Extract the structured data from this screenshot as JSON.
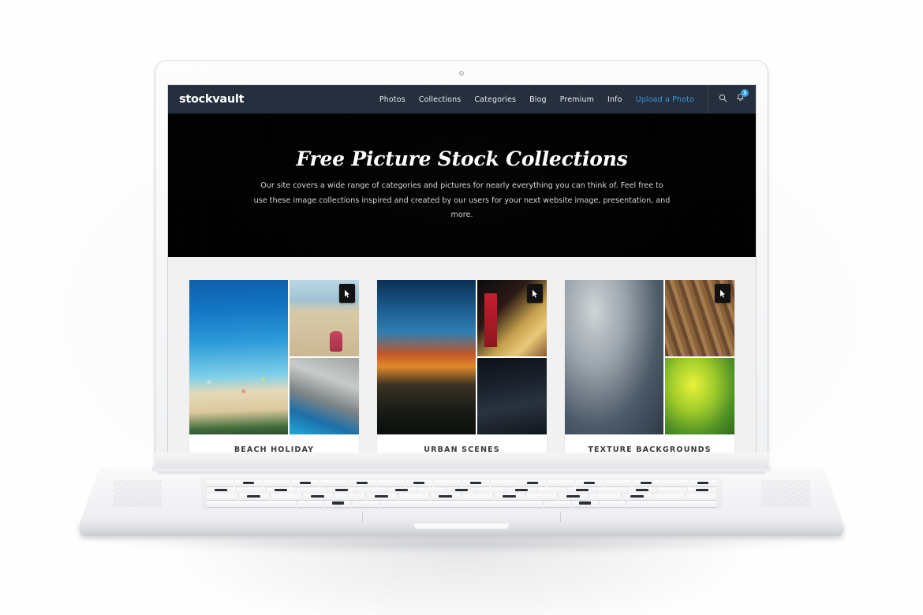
{
  "site": {
    "logo": "stockvault",
    "nav": [
      {
        "label": "Photos",
        "accent": false
      },
      {
        "label": "Collections",
        "accent": false
      },
      {
        "label": "Categories",
        "accent": false
      },
      {
        "label": "Blog",
        "accent": false
      },
      {
        "label": "Premium",
        "accent": false
      },
      {
        "label": "Info",
        "accent": false
      },
      {
        "label": "Upload a Photo",
        "accent": true
      }
    ],
    "icons": {
      "search": "search-icon",
      "bell": "bell-icon"
    },
    "notification_count": "3",
    "accent_color": "#3d96d8",
    "navbar_color": "#252f3d"
  },
  "hero": {
    "title": "Free Picture Stock Collections",
    "subtitle": "Our site covers a wide range of categories and pictures for nearly everything you can think of. Feel free to use these image collections inspired and created by our users for your next website image, presentation, and more.",
    "background_color": "#0a0a0a"
  },
  "collections": [
    {
      "title": "BEACH HOLIDAY",
      "meta": "",
      "badge_icon": "cursor-arrow-icon"
    },
    {
      "title": "URBAN SCENES",
      "meta": "",
      "badge_icon": "cursor-arrow-icon"
    },
    {
      "title": "TEXTURE BACKGROUNDS",
      "meta": "",
      "badge_icon": "cursor-arrow-icon"
    }
  ],
  "content": {
    "background_color": "#f1f1f1"
  },
  "device": {
    "type": "laptop-mockup",
    "body_color": "#f7f7f8"
  }
}
